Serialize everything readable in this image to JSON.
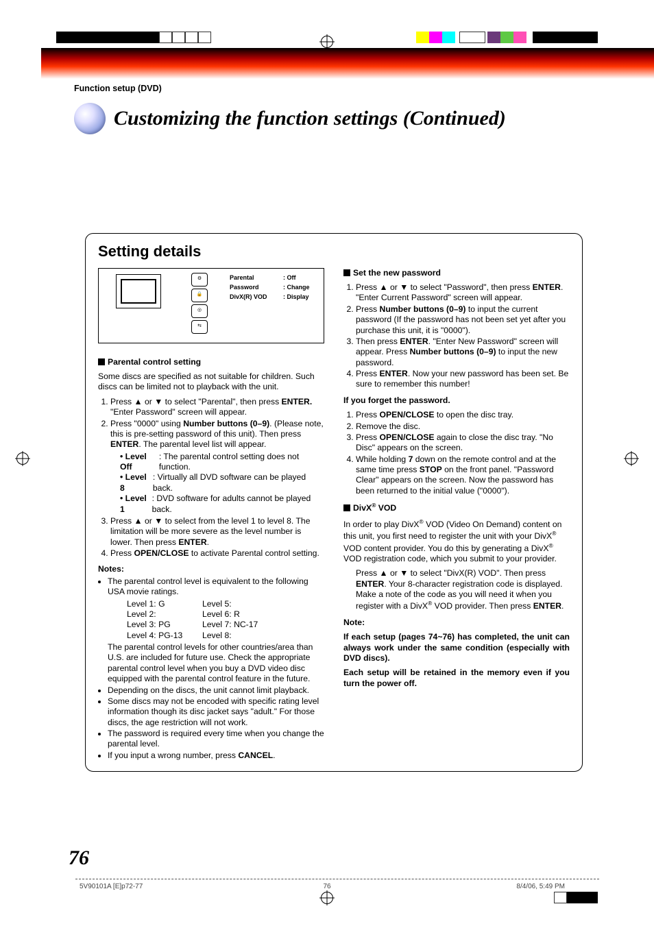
{
  "header": {
    "section_label": "Function setup (DVD)",
    "main_title": "Customizing the function settings (Continued)"
  },
  "setting_details": {
    "heading": "Setting details",
    "menu": {
      "parental_lbl": "Parental",
      "parental_val": ": Off",
      "password_lbl": "Password",
      "password_val": ": Change",
      "divx_lbl": "DivX(R) VOD",
      "divx_val": ": Display"
    },
    "left": {
      "parental_heading": "Parental control setting",
      "parental_intro": "Some discs are specified as not suitable for children. Such discs can be limited not to playback with the unit.",
      "step1a": "Press ▲ or ▼ to select \"Parental\", then press ",
      "step1b_bold": "ENTER.",
      "step1c": " \"Enter Password\" screen will appear.",
      "step2a": "Press \"0000\" using ",
      "step2b_bold": "Number buttons (0–9)",
      "step2c": ". (Please note, this is pre-setting password of this unit). Then press ",
      "step2d_bold": "ENTER",
      "step2e": ". The parental level list will appear.",
      "lvl_off_lbl": "• Level Off",
      "lvl_off_txt": ": The parental control setting does not function.",
      "lvl_8_lbl": "• Level 8",
      "lvl_8_txt": ":   Virtually all DVD software can be played back.",
      "lvl_1_lbl": "• Level 1",
      "lvl_1_txt": ":   DVD software for adults cannot be played back.",
      "step3a": "Press ▲ or ▼ to select from the level 1 to level 8. The limitation will be more severe as the level number is lower. Then press ",
      "step3b_bold": "ENTER",
      "step3c": ".",
      "step4a": "Press ",
      "step4b_bold": "OPEN/CLOSE",
      "step4c": " to activate Parental control setting.",
      "notes_heading": "Notes:",
      "note1_intro": "The parental control level is equivalent to the following USA movie ratings.",
      "ratings": {
        "l1": "Level 1: G",
        "l5": "Level 5:",
        "l2": "Level 2:",
        "l6": "Level 6: R",
        "l3": "Level 3: PG",
        "l7": "Level 7: NC-17",
        "l4": "Level 4: PG-13",
        "l8": "Level 8:"
      },
      "note1_cont": "The parental control levels for other countries/area than U.S. are included for future use. Check the appropriate parental control level when you buy a DVD video disc equipped with the parental control feature in the future.",
      "note2": "Depending on the discs, the unit cannot limit playback.",
      "note3": "Some discs may not be encoded with specific rating level information though its disc jacket says \"adult.\" For those discs, the age restriction will not work.",
      "note4": "The password is required every time when you change the parental level.",
      "note5a": "If you input a wrong number, press ",
      "note5b_bold": "CANCEL",
      "note5c": "."
    },
    "right": {
      "set_pw_heading": "Set the new password",
      "pw1a": "Press ▲ or ▼ to select \"Password\", then press ",
      "pw1b_bold": "ENTER",
      "pw1c": ". \"Enter Current Password\" screen will appear.",
      "pw2a": "Press ",
      "pw2b_bold": "Number buttons (0–9)",
      "pw2c": " to input the current password (If the password has not been set yet after you purchase this unit, it is \"0000\").",
      "pw3a": "Then press ",
      "pw3b_bold": "ENTER",
      "pw3c": ". \"Enter New Password\" screen will appear. Press ",
      "pw3d_bold": "Number buttons (0–9)",
      "pw3e": " to input the new password.",
      "pw4a": "Press ",
      "pw4b_bold": "ENTER",
      "pw4c": ". Now your new password has been set. Be sure to remember this number!",
      "forgot_heading": "If you forget the password.",
      "fg1a": "Press ",
      "fg1b_bold": "OPEN/CLOSE",
      "fg1c": " to open the disc tray.",
      "fg2": "Remove the disc.",
      "fg3a": "Press ",
      "fg3b_bold": "OPEN/CLOSE",
      "fg3c": " again to close the disc tray. \"No Disc\" appears on the screen.",
      "fg4a": "While holding ",
      "fg4b_bold": "7",
      "fg4c": " down on the remote control and at the same time press ",
      "fg4d_bold": "STOP",
      "fg4e": " on the front panel. \"Password Clear\" appears on the screen. Now the password has been returned to the initial value (\"0000\").",
      "divx_heading_a": "DivX",
      "divx_heading_b": " VOD",
      "divx_p1a": "In order to play DivX",
      "divx_p1b": " VOD (Video On Demand) content on this unit, you first need to register the unit with your DivX",
      "divx_p1c": " VOD content provider. You do this by generating a DivX",
      "divx_p1d": " VOD registration code, which you submit to your provider.",
      "divx_p2a": "Press ▲ or ▼ to select \"DivX(R) VOD\". Then press ",
      "divx_p2b_bold": "ENTER",
      "divx_p2c": ". Your 8-character registration code is displayed. Make a note of the code as you will need it when you register with a DivX",
      "divx_p2d": " VOD provider. Then press ",
      "divx_p2e_bold": "ENTER",
      "divx_p2f": ".",
      "final_note_heading": "Note:",
      "final_note_1": "If each setup (pages 74~76) has completed, the unit can always work under the same condition (especially with DVD discs).",
      "final_note_2": "Each setup will be retained in the memory even if you turn the power off."
    }
  },
  "footer": {
    "page_num": "76",
    "doc_id": "5V90101A [E]p72-77",
    "sheet_num": "76",
    "timestamp": "8/4/06, 5:49 PM"
  }
}
